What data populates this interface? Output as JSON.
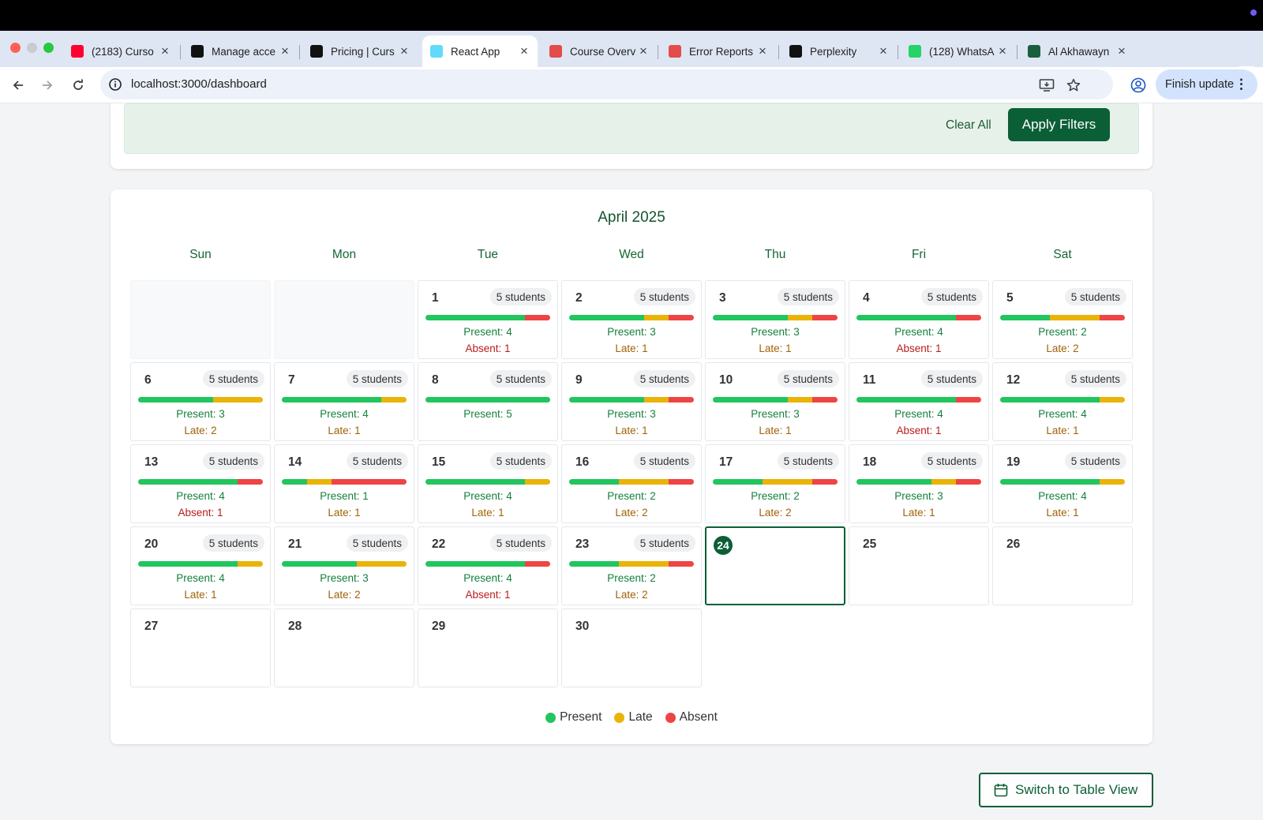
{
  "browser": {
    "tabs": [
      {
        "title": "(2183) Curso",
        "icon": "youtube-icon",
        "color": "#ff0033"
      },
      {
        "title": "Manage acce",
        "icon": "github-icon",
        "color": "#111111"
      },
      {
        "title": "Pricing | Curs",
        "icon": "cursor-icon",
        "color": "#111111"
      },
      {
        "title": "React App",
        "icon": "react-icon",
        "color": "#61dafb",
        "active": true
      },
      {
        "title": "Course Overv",
        "icon": "course-icon",
        "color": "#e24c4b"
      },
      {
        "title": "Error Reports",
        "icon": "error-reports-icon",
        "color": "#e24c4b"
      },
      {
        "title": "Perplexity",
        "icon": "perplexity-icon",
        "color": "#111111"
      },
      {
        "title": "(128) WhatsA",
        "icon": "whatsapp-icon",
        "color": "#25d366"
      },
      {
        "title": "Al Akhawayn",
        "icon": "aui-icon",
        "color": "#1b5e3b"
      }
    ],
    "url": "localhost:3000/dashboard",
    "finish_update": "Finish update"
  },
  "filters": {
    "clear_label": "Clear All",
    "apply_label": "Apply Filters"
  },
  "calendar": {
    "month_title": "April 2025",
    "weekdays": [
      "Sun",
      "Mon",
      "Tue",
      "Wed",
      "Thu",
      "Fri",
      "Sat"
    ],
    "leading_empty": 2,
    "today": 24,
    "days": [
      {
        "day": "1",
        "students": "5 students",
        "present": 4,
        "late": 0,
        "absent": 1,
        "line1": "Present: 4",
        "line2": "Absent: 1",
        "line2_type": "absent"
      },
      {
        "day": "2",
        "students": "5 students",
        "present": 3,
        "late": 1,
        "absent": 1,
        "line1": "Present: 3",
        "line2": "Late: 1",
        "line2_type": "late"
      },
      {
        "day": "3",
        "students": "5 students",
        "present": 3,
        "late": 1,
        "absent": 1,
        "line1": "Present: 3",
        "line2": "Late: 1",
        "line2_type": "late"
      },
      {
        "day": "4",
        "students": "5 students",
        "present": 4,
        "late": 0,
        "absent": 1,
        "line1": "Present: 4",
        "line2": "Absent: 1",
        "line2_type": "absent"
      },
      {
        "day": "5",
        "students": "5 students",
        "present": 2,
        "late": 2,
        "absent": 1,
        "line1": "Present: 2",
        "line2": "Late: 2",
        "line2_type": "late"
      },
      {
        "day": "6",
        "students": "5 students",
        "present": 3,
        "late": 2,
        "absent": 0,
        "line1": "Present: 3",
        "line2": "Late: 2",
        "line2_type": "late"
      },
      {
        "day": "7",
        "students": "5 students",
        "present": 4,
        "late": 1,
        "absent": 0,
        "line1": "Present: 4",
        "line2": "Late: 1",
        "line2_type": "late"
      },
      {
        "day": "8",
        "students": "5 students",
        "present": 5,
        "late": 0,
        "absent": 0,
        "line1": "Present: 5",
        "line2": "",
        "line2_type": "none"
      },
      {
        "day": "9",
        "students": "5 students",
        "present": 3,
        "late": 1,
        "absent": 1,
        "line1": "Present: 3",
        "line2": "Late: 1",
        "line2_type": "late"
      },
      {
        "day": "10",
        "students": "5 students",
        "present": 3,
        "late": 1,
        "absent": 1,
        "line1": "Present: 3",
        "line2": "Late: 1",
        "line2_type": "late"
      },
      {
        "day": "11",
        "students": "5 students",
        "present": 4,
        "late": 0,
        "absent": 1,
        "line1": "Present: 4",
        "line2": "Absent: 1",
        "line2_type": "absent"
      },
      {
        "day": "12",
        "students": "5 students",
        "present": 4,
        "late": 1,
        "absent": 0,
        "line1": "Present: 4",
        "line2": "Late: 1",
        "line2_type": "late"
      },
      {
        "day": "13",
        "students": "5 students",
        "present": 4,
        "late": 0,
        "absent": 1,
        "line1": "Present: 4",
        "line2": "Absent: 1",
        "line2_type": "absent"
      },
      {
        "day": "14",
        "students": "5 students",
        "present": 1,
        "late": 1,
        "absent": 3,
        "line1": "Present: 1",
        "line2": "Late: 1",
        "line2_type": "late"
      },
      {
        "day": "15",
        "students": "5 students",
        "present": 4,
        "late": 1,
        "absent": 0,
        "line1": "Present: 4",
        "line2": "Late: 1",
        "line2_type": "late"
      },
      {
        "day": "16",
        "students": "5 students",
        "present": 2,
        "late": 2,
        "absent": 1,
        "line1": "Present: 2",
        "line2": "Late: 2",
        "line2_type": "late"
      },
      {
        "day": "17",
        "students": "5 students",
        "present": 2,
        "late": 2,
        "absent": 1,
        "line1": "Present: 2",
        "line2": "Late: 2",
        "line2_type": "late"
      },
      {
        "day": "18",
        "students": "5 students",
        "present": 3,
        "late": 1,
        "absent": 1,
        "line1": "Present: 3",
        "line2": "Late: 1",
        "line2_type": "late"
      },
      {
        "day": "19",
        "students": "5 students",
        "present": 4,
        "late": 1,
        "absent": 0,
        "line1": "Present: 4",
        "line2": "Late: 1",
        "line2_type": "late"
      },
      {
        "day": "20",
        "students": "5 students",
        "present": 4,
        "late": 1,
        "absent": 0,
        "line1": "Present: 4",
        "line2": "Late: 1",
        "line2_type": "late"
      },
      {
        "day": "21",
        "students": "5 students",
        "present": 3,
        "late": 2,
        "absent": 0,
        "line1": "Present: 3",
        "line2": "Late: 2",
        "line2_type": "late"
      },
      {
        "day": "22",
        "students": "5 students",
        "present": 4,
        "late": 0,
        "absent": 1,
        "line1": "Present: 4",
        "line2": "Absent: 1",
        "line2_type": "absent"
      },
      {
        "day": "23",
        "students": "5 students",
        "present": 2,
        "late": 2,
        "absent": 1,
        "line1": "Present: 2",
        "line2": "Late: 2",
        "line2_type": "late"
      },
      {
        "day": "24"
      },
      {
        "day": "25"
      },
      {
        "day": "26"
      },
      {
        "day": "27"
      },
      {
        "day": "28"
      },
      {
        "day": "29"
      },
      {
        "day": "30"
      }
    ],
    "legend": [
      {
        "label": "Present",
        "color": "#22c55e"
      },
      {
        "label": "Late",
        "color": "#eab308"
      },
      {
        "label": "Absent",
        "color": "#ef4444"
      }
    ]
  },
  "switch_view_label": "Switch to Table View"
}
